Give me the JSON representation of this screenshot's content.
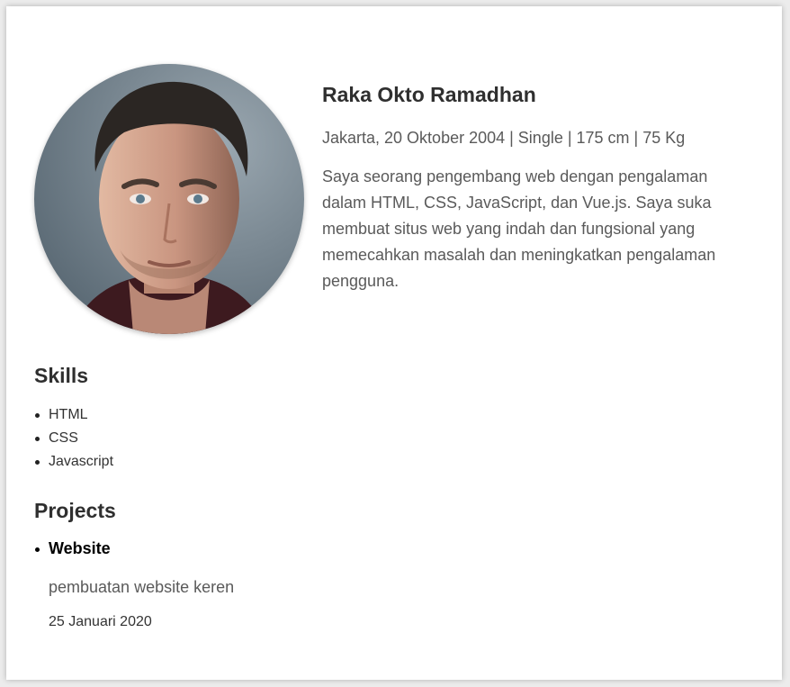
{
  "profile": {
    "name": "Raka Okto Ramadhan",
    "meta": "Jakarta, 20 Oktober 2004 | Single | 175 cm | 75 Kg",
    "bio": "Saya seorang pengembang web dengan pengalaman dalam HTML, CSS, JavaScript, dan Vue.js. Saya suka membuat situs web yang indah dan fungsional yang memecahkan masalah dan meningkatkan pengalaman pengguna.",
    "photo_alt": "profile photo"
  },
  "skills": {
    "title": "Skills",
    "items": [
      "HTML",
      "CSS",
      "Javascript"
    ]
  },
  "projects": {
    "title": "Projects",
    "items": [
      {
        "name": "Website",
        "description": "pembuatan website keren",
        "date": "25 Januari 2020"
      }
    ]
  },
  "colors": {
    "card_background": "#ffffff",
    "page_background": "#ececec",
    "heading_text": "#2f2f2f",
    "body_text": "#5a5a5a"
  }
}
